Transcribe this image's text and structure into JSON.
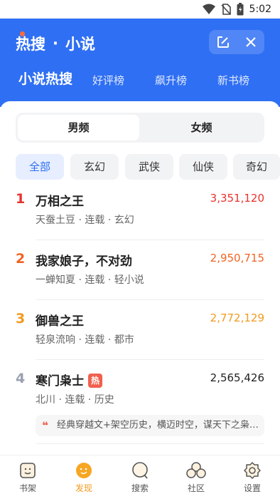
{
  "status": {
    "time": "5:02"
  },
  "header": {
    "brand": "热搜",
    "separator": "·",
    "section": "小说",
    "tabs": [
      "小说热搜",
      "好评榜",
      "飙升榜",
      "新书榜"
    ]
  },
  "gender": [
    "男频",
    "女频"
  ],
  "genres": [
    "全部",
    "玄幻",
    "武侠",
    "仙侠",
    "奇幻"
  ],
  "books": [
    {
      "rank": "1",
      "title": "万相之王",
      "meta": "天蚕土豆 · 连载 · 玄幻",
      "count": "3,351,120",
      "color": "#e8322c"
    },
    {
      "rank": "2",
      "title": "我家娘子，不对劲",
      "meta": "一蝉知夏 · 连载 · 轻小说",
      "count": "2,950,715",
      "color": "#f06423"
    },
    {
      "rank": "3",
      "title": "御兽之王",
      "meta": "轻泉流响 · 连载 · 都市",
      "count": "2,772,129",
      "color": "#f29a1e"
    },
    {
      "rank": "4",
      "title": "寒门枭士",
      "badge": "热",
      "meta": "北川 · 连载 · 历史",
      "count": "2,565,426",
      "color": "#9aa0b0",
      "quote": "经典穿越文+架空历史，横迈时空，谋天下之枭士..."
    }
  ],
  "nav": [
    "书架",
    "发现",
    "搜索",
    "社区",
    "设置"
  ],
  "colors": {
    "primary": "#2f6ff3",
    "accent": "#f29a1e"
  }
}
